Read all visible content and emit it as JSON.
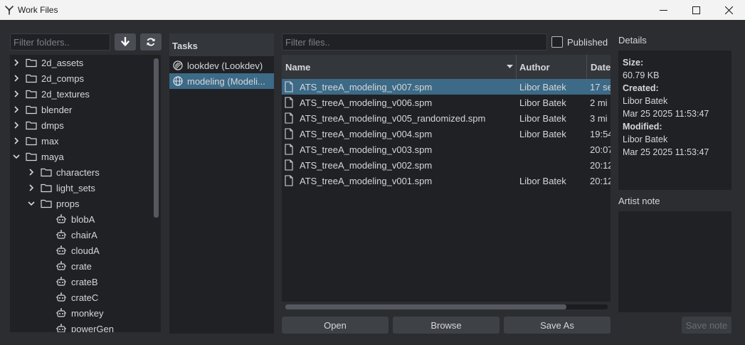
{
  "window": {
    "title": "Work Files"
  },
  "folders": {
    "filter_placeholder": "Filter folders..",
    "items": [
      {
        "label": "2d_assets",
        "depth": 0,
        "state": "collapsed",
        "kind": "folder"
      },
      {
        "label": "2d_comps",
        "depth": 0,
        "state": "collapsed",
        "kind": "folder"
      },
      {
        "label": "2d_textures",
        "depth": 0,
        "state": "collapsed",
        "kind": "folder"
      },
      {
        "label": "blender",
        "depth": 0,
        "state": "collapsed",
        "kind": "folder"
      },
      {
        "label": "dmps",
        "depth": 0,
        "state": "collapsed",
        "kind": "folder"
      },
      {
        "label": "max",
        "depth": 0,
        "state": "collapsed",
        "kind": "folder"
      },
      {
        "label": "maya",
        "depth": 0,
        "state": "expanded",
        "kind": "folder"
      },
      {
        "label": "characters",
        "depth": 1,
        "state": "collapsed",
        "kind": "folder"
      },
      {
        "label": "light_sets",
        "depth": 1,
        "state": "collapsed",
        "kind": "folder"
      },
      {
        "label": "props",
        "depth": 1,
        "state": "expanded",
        "kind": "folder"
      },
      {
        "label": "blobA",
        "depth": 2,
        "state": "leaf",
        "kind": "asset"
      },
      {
        "label": "chairA",
        "depth": 2,
        "state": "leaf",
        "kind": "asset"
      },
      {
        "label": "cloudA",
        "depth": 2,
        "state": "leaf",
        "kind": "asset"
      },
      {
        "label": "crate",
        "depth": 2,
        "state": "leaf",
        "kind": "asset"
      },
      {
        "label": "crateB",
        "depth": 2,
        "state": "leaf",
        "kind": "asset"
      },
      {
        "label": "crateC",
        "depth": 2,
        "state": "leaf",
        "kind": "asset"
      },
      {
        "label": "monkey",
        "depth": 2,
        "state": "leaf",
        "kind": "asset"
      },
      {
        "label": "powerGen",
        "depth": 2,
        "state": "leaf",
        "kind": "asset"
      }
    ]
  },
  "tasks": {
    "header": "Tasks",
    "items": [
      {
        "label": "lookdev (Lookdev)",
        "icon": "lookdev-icon",
        "selected": false
      },
      {
        "label": "modeling (Modeli...",
        "icon": "globe-icon",
        "selected": true
      }
    ]
  },
  "files": {
    "filter_placeholder": "Filter files..",
    "published_label": "Published",
    "published_checked": false,
    "columns": {
      "name": "Name",
      "author": "Author",
      "date": "Date"
    },
    "rows": [
      {
        "name": "ATS_treeA_modeling_v007.spm",
        "author": "Libor Batek",
        "date": "17 se",
        "selected": true
      },
      {
        "name": "ATS_treeA_modeling_v006.spm",
        "author": "Libor Batek",
        "date": "2 mi",
        "selected": false
      },
      {
        "name": "ATS_treeA_modeling_v005_randomized.spm",
        "author": "Libor Batek",
        "date": "3 mi",
        "selected": false
      },
      {
        "name": "ATS_treeA_modeling_v004.spm",
        "author": "Libor Batek",
        "date": "19:54",
        "selected": false
      },
      {
        "name": "ATS_treeA_modeling_v003.spm",
        "author": "",
        "date": "20:07",
        "selected": false
      },
      {
        "name": "ATS_treeA_modeling_v002.spm",
        "author": "",
        "date": "20:12",
        "selected": false
      },
      {
        "name": "ATS_treeA_modeling_v001.spm",
        "author": "Libor Batek",
        "date": "20:12",
        "selected": false
      }
    ],
    "buttons": {
      "open": "Open",
      "browse": "Browse",
      "save_as": "Save As"
    }
  },
  "details": {
    "label": "Details",
    "size_key": "Size:",
    "size_val": "60.79 KB",
    "created_key": "Created:",
    "created_by": "Libor Batek",
    "created_at": "Mar 25 2025 11:53:47",
    "modified_key": "Modified:",
    "modified_by": "Libor Batek",
    "modified_at": "Mar 25 2025 11:53:47",
    "artist_note_label": "Artist note",
    "save_note": "Save note"
  },
  "colors": {
    "selection": "#3c6a87",
    "panel": "#1f2125",
    "background": "#2b2d31"
  }
}
